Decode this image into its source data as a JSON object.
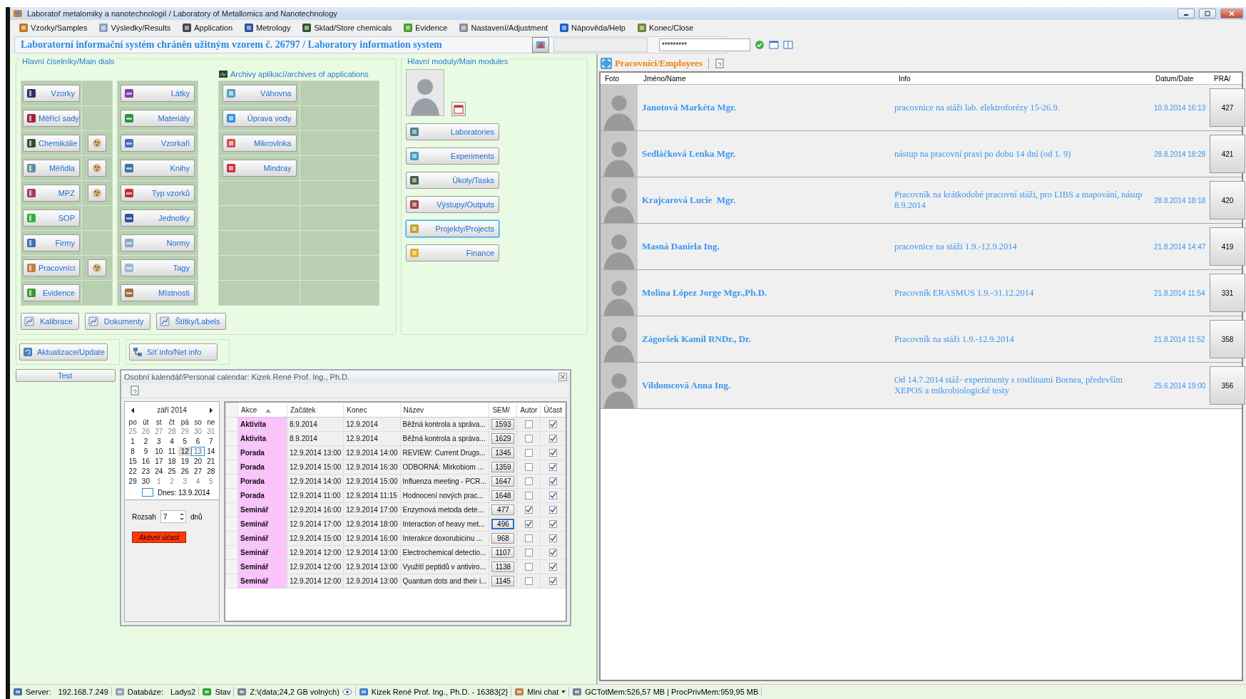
{
  "window": {
    "title": "Laboratoř metalomiky a nanotechnologií / Laboratory of Metallomics and Nanotechnology"
  },
  "menu": [
    {
      "label": "Vzorky/Samples"
    },
    {
      "label": "Výsledky/Results"
    },
    {
      "label": "Application"
    },
    {
      "label": "Metrology"
    },
    {
      "label": "Sklad/Store chemicals"
    },
    {
      "label": "Evidence"
    },
    {
      "label": "Nastavení/Adjustment"
    },
    {
      "label": "Nápověda/Help"
    },
    {
      "label": "Konec/Close"
    }
  ],
  "banner": "Laboratorní informační systém chráněn užitným vzorem č. 26797 / Laboratory information system",
  "login": {
    "password": "*********"
  },
  "dials": {
    "title": "Hlavní číselníky/Main dials",
    "column_1": [
      {
        "label": "Vzorky",
        "shortcut": false
      },
      {
        "label": "Měřící sady",
        "shortcut": false
      },
      {
        "label": "Chemikálie",
        "shortcut": true
      },
      {
        "label": "Měřidla",
        "shortcut": true
      },
      {
        "label": "MPZ",
        "shortcut": true
      },
      {
        "label": "SOP",
        "shortcut": false
      },
      {
        "label": "Firmy",
        "shortcut": false
      },
      {
        "label": "Pracovníci",
        "shortcut": true
      },
      {
        "label": "Evidence",
        "shortcut": false
      }
    ],
    "column_2": [
      "Látky",
      "Materiály",
      "Vzorkaři",
      "Knihy",
      "Typ vzorků",
      "Jednotky",
      "Normy",
      "Tagy",
      "Místnosti"
    ],
    "bottom_buttons": [
      "Kalibrace",
      "Dokumenty",
      "Štítky/Labels"
    ]
  },
  "archives": {
    "title": "Archivy aplikací/archives of applications",
    "items": [
      "Váhovna",
      "Úprava vody",
      "Mikrovlnka",
      "Mindray"
    ]
  },
  "modules": {
    "title": "Hlavní moduly/Main modules",
    "items": [
      {
        "label": "Laboratories",
        "selected": false
      },
      {
        "label": "Experiments",
        "selected": false
      },
      {
        "label": "Úkoly/Tasks",
        "selected": false
      },
      {
        "label": "Výstupy/Outputs",
        "selected": false
      },
      {
        "label": "Projekty/Projects",
        "selected": true
      },
      {
        "label": "Finance",
        "selected": false
      }
    ]
  },
  "actions": {
    "update": "Aktualizace/Update",
    "net_info": "Síť info/Net info",
    "test": "Test"
  },
  "calendar": {
    "title": "Osobní kalendář/Personal calendar: Kizek René Prof. Ing., Ph.D.",
    "month": "září 2014",
    "weekdays": [
      "po",
      "út",
      "st",
      "čt",
      "pá",
      "so",
      "ne"
    ],
    "weeks": [
      [
        {
          "d": "25",
          "other": true,
          "selected": false,
          "today": false
        },
        {
          "d": "26",
          "other": true,
          "selected": false,
          "today": false
        },
        {
          "d": "27",
          "other": true,
          "selected": false,
          "today": false
        },
        {
          "d": "28",
          "other": true,
          "selected": false,
          "today": false
        },
        {
          "d": "29",
          "other": true,
          "selected": false,
          "today": false
        },
        {
          "d": "30",
          "other": true,
          "selected": false,
          "today": false
        },
        {
          "d": "31",
          "other": true,
          "selected": false,
          "today": false
        }
      ],
      [
        {
          "d": "1",
          "other": false,
          "selected": false,
          "today": false
        },
        {
          "d": "2",
          "other": false,
          "selected": false,
          "today": false
        },
        {
          "d": "3",
          "other": false,
          "selected": false,
          "today": false
        },
        {
          "d": "4",
          "other": false,
          "selected": false,
          "today": false
        },
        {
          "d": "5",
          "other": false,
          "selected": false,
          "today": false
        },
        {
          "d": "6",
          "other": false,
          "selected": false,
          "today": false
        },
        {
          "d": "7",
          "other": false,
          "selected": false,
          "today": false
        }
      ],
      [
        {
          "d": "8",
          "other": false,
          "selected": false,
          "today": false
        },
        {
          "d": "9",
          "other": false,
          "selected": false,
          "today": false
        },
        {
          "d": "10",
          "other": false,
          "selected": false,
          "today": false
        },
        {
          "d": "11",
          "other": false,
          "selected": false,
          "today": false
        },
        {
          "d": "12",
          "other": false,
          "selected": true,
          "today": false
        },
        {
          "d": "13",
          "other": false,
          "selected": false,
          "today": true
        },
        {
          "d": "14",
          "other": false,
          "selected": false,
          "today": false
        }
      ],
      [
        {
          "d": "15",
          "other": false,
          "selected": false,
          "today": false
        },
        {
          "d": "16",
          "other": false,
          "selected": false,
          "today": false
        },
        {
          "d": "17",
          "other": false,
          "selected": false,
          "today": false
        },
        {
          "d": "18",
          "other": false,
          "selected": false,
          "today": false
        },
        {
          "d": "19",
          "other": false,
          "selected": false,
          "today": false
        },
        {
          "d": "20",
          "other": false,
          "selected": false,
          "today": false
        },
        {
          "d": "21",
          "other": false,
          "selected": false,
          "today": false
        }
      ],
      [
        {
          "d": "22",
          "other": false,
          "selected": false,
          "today": false
        },
        {
          "d": "23",
          "other": false,
          "selected": false,
          "today": false
        },
        {
          "d": "24",
          "other": false,
          "selected": false,
          "today": false
        },
        {
          "d": "25",
          "other": false,
          "selected": false,
          "today": false
        },
        {
          "d": "26",
          "other": false,
          "selected": false,
          "today": false
        },
        {
          "d": "27",
          "other": false,
          "selected": false,
          "today": false
        },
        {
          "d": "28",
          "other": false,
          "selected": false,
          "today": false
        }
      ],
      [
        {
          "d": "29",
          "other": false,
          "selected": false,
          "today": false
        },
        {
          "d": "30",
          "other": false,
          "selected": false,
          "today": false
        },
        {
          "d": "1",
          "other": true,
          "selected": false,
          "today": false
        },
        {
          "d": "2",
          "other": true,
          "selected": false,
          "today": false
        },
        {
          "d": "3",
          "other": true,
          "selected": false,
          "today": false
        },
        {
          "d": "4",
          "other": true,
          "selected": false,
          "today": false
        },
        {
          "d": "5",
          "other": true,
          "selected": false,
          "today": false
        }
      ]
    ],
    "today_label": "Dnes: 13.9.2014",
    "range_label": "Rozsah",
    "range_value": "7",
    "range_unit": "dnů",
    "active_button": "Aktivní účast",
    "columns": [
      "Akce",
      "Začátek",
      "Konec",
      "Název",
      "SEM/",
      "Autor",
      "Účast"
    ],
    "rows": [
      {
        "action": "Aktivita",
        "start": "8.9.2014",
        "end": "12.9.2014",
        "name": "Běžná kontrola a správa...",
        "sem": "1593",
        "author": false,
        "participation": true,
        "selected": false
      },
      {
        "action": "Aktivita",
        "start": "8.9.2014",
        "end": "12.9.2014",
        "name": "Běžná kontrola a správa...",
        "sem": "1629",
        "author": false,
        "participation": true,
        "selected": false
      },
      {
        "action": "Porada",
        "start": "12.9.2014 13:00",
        "end": "12.9.2014 14:00",
        "name": "REVIEW: Current Drugs...",
        "sem": "1345",
        "author": false,
        "participation": true,
        "selected": false
      },
      {
        "action": "Porada",
        "start": "12.9.2014 15:00",
        "end": "12.9.2014 16:30",
        "name": "ODBORNÁ: Mirkobiom ...",
        "sem": "1359",
        "author": false,
        "participation": true,
        "selected": false
      },
      {
        "action": "Porada",
        "start": "12.9.2014 14:00",
        "end": "12.9.2014 15:00",
        "name": "Influenza meeting - PCR...",
        "sem": "1647",
        "author": false,
        "participation": true,
        "selected": false
      },
      {
        "action": "Porada",
        "start": "12.9.2014 11:00",
        "end": "12.9.2014 11:15",
        "name": "Hodnocení nových prac...",
        "sem": "1648",
        "author": false,
        "participation": true,
        "selected": false
      },
      {
        "action": "Seminář",
        "start": "12.9.2014 16:00",
        "end": "12.9.2014 17:00",
        "name": "Enzymová metoda dete...",
        "sem": "477",
        "author": true,
        "participation": true,
        "selected": false
      },
      {
        "action": "Seminář",
        "start": "12.9.2014 17:00",
        "end": "12.9.2014 18:00",
        "name": "Interaction of heavy met...",
        "sem": "496",
        "author": true,
        "participation": true,
        "selected": true
      },
      {
        "action": "Seminář",
        "start": "12.9.2014 15:00",
        "end": "12.9.2014 16:00",
        "name": "Interakce doxorubicinu ...",
        "sem": "968",
        "author": false,
        "participation": true,
        "selected": false
      },
      {
        "action": "Seminář",
        "start": "12.9.2014 12:00",
        "end": "12.9.2014 13:00",
        "name": "Electrochemical detectio...",
        "sem": "1107",
        "author": false,
        "participation": true,
        "selected": false
      },
      {
        "action": "Seminář",
        "start": "12.9.2014 12:00",
        "end": "12.9.2014 13:00",
        "name": "Využití peptidů v antiviro...",
        "sem": "1138",
        "author": false,
        "participation": true,
        "selected": false
      },
      {
        "action": "Seminář",
        "start": "12.9.2014 12:00",
        "end": "12.9.2014 13:00",
        "name": "Quantum dots and their i...",
        "sem": "1145",
        "author": false,
        "participation": true,
        "selected": false
      }
    ]
  },
  "employees": {
    "title": "Pracovníci/Employees",
    "columns": [
      "Foto",
      "Jméno/Name",
      "Info",
      "Datum/Date",
      "PRA/"
    ],
    "rows": [
      {
        "name": "Janotová Markéta Mgr.",
        "info": "pracovnice na stáži lab. elektroforézy 15-26.9.",
        "date": "10.9.2014 16:13",
        "id": "427"
      },
      {
        "name": "Sedláčková Lenka Mgr.",
        "info": "nástup na pracovní praxi po dobu 14 dní (od 1. 9)",
        "date": "28.8.2014 18:28",
        "id": "421"
      },
      {
        "name": "Krajcarová Lucie  Mgr.",
        "info": "Pracovník na krátkodobé pracovní stáži, pro LIBS a mapování, násup 8.9.2014",
        "date": "28.8.2014 18:18",
        "id": "420"
      },
      {
        "name": "Masná Daniela Ing.",
        "info": "pracovnice na stáži 1.9.-12.9.2014",
        "date": "21.8.2014 14:47",
        "id": "419"
      },
      {
        "name": "Molina López Jorge Mgr.,Ph.D.",
        "info": "Pracovník ERASMUS 1.9.-31.12.2014",
        "date": "21.8.2014 11:54",
        "id": "331"
      },
      {
        "name": "Zágoršek Kamil RNDr., Dr.",
        "info": "Pracovník na stáži 1.9.-12.9.2014",
        "date": "21.8.2014 11:52",
        "id": "358"
      },
      {
        "name": "Vildomcová Anna Ing.",
        "info": "Od 14.7.2014 stáž- experimenty s rostlinami Bornea, především XEPOS a mikrobiologické testy",
        "date": "25.6.2014 19:00",
        "id": "356"
      }
    ]
  },
  "status_bar": [
    {
      "label": "Server:",
      "value": "192.168.7.249"
    },
    {
      "label": "Databáze:",
      "value": "Ladys2"
    },
    {
      "label": "Stav"
    },
    {
      "label": "Z:\\(data;24,2 GB volných)"
    },
    {
      "label": "Kizek René Prof. Ing., Ph.D. - 16383{2}"
    },
    {
      "label": "Mini chat"
    },
    {
      "label": "GCTotMem:526,57 MB | ProcPrivMem:959,95 MB"
    }
  ]
}
